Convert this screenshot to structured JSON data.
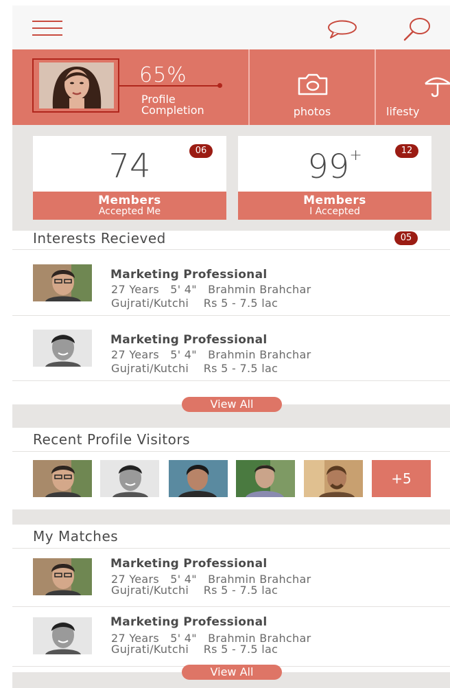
{
  "header": {
    "menu_icon": "hamburger-menu-icon",
    "chat_icon": "chat-bubble-icon",
    "search_icon": "search-icon"
  },
  "profile_band": {
    "completion_percent": "65%",
    "completion_label_line1": "Profile",
    "completion_label_line2": "Completion",
    "photos_label": "photos",
    "photos_icon": "camera-icon",
    "lifestyle_label": "lifesty",
    "lifestyle_icon": "umbrella-icon"
  },
  "stats": {
    "accepted_me": {
      "count": "74",
      "badge": "06",
      "title": "Members",
      "subtitle": "Accepted Me"
    },
    "i_accepted": {
      "count": "99",
      "plus": "+",
      "badge": "12",
      "title": "Members",
      "subtitle": "I Accepted"
    }
  },
  "interests": {
    "title": "Interests Recieved",
    "badge": "05",
    "items": [
      {
        "title": "Marketing Professional",
        "line1": "27 Years   5' 4\"   Brahmin Brahchar",
        "line2": "Gujrati/Kutchi    Rs 5 - 7.5 lac"
      },
      {
        "title": "Marketing Professional",
        "line1": "27 Years   5' 4\"   Brahmin Brahchar",
        "line2": "Gujrati/Kutchi    Rs 5 - 7.5 lac"
      }
    ],
    "view_all": "View All"
  },
  "visitors": {
    "title": "Recent Profile Visitors",
    "more": "+5"
  },
  "matches": {
    "title": "My Matches",
    "items": [
      {
        "title": "Marketing Professional",
        "line1": "27 Years   5' 4\"   Brahmin Brahchar",
        "line2": "Gujrati/Kutchi    Rs 5 - 7.5 lac"
      },
      {
        "title": "Marketing Professional",
        "line1": "27 Years   5' 4\"   Brahmin Brahchar",
        "line2": "Gujrati/Kutchi    Rs 5 - 7.5 lac"
      }
    ],
    "view_all": "View All"
  },
  "colors": {
    "accent": "#de7566",
    "badge": "#9b1c13",
    "divider": "#e7e5e3"
  }
}
